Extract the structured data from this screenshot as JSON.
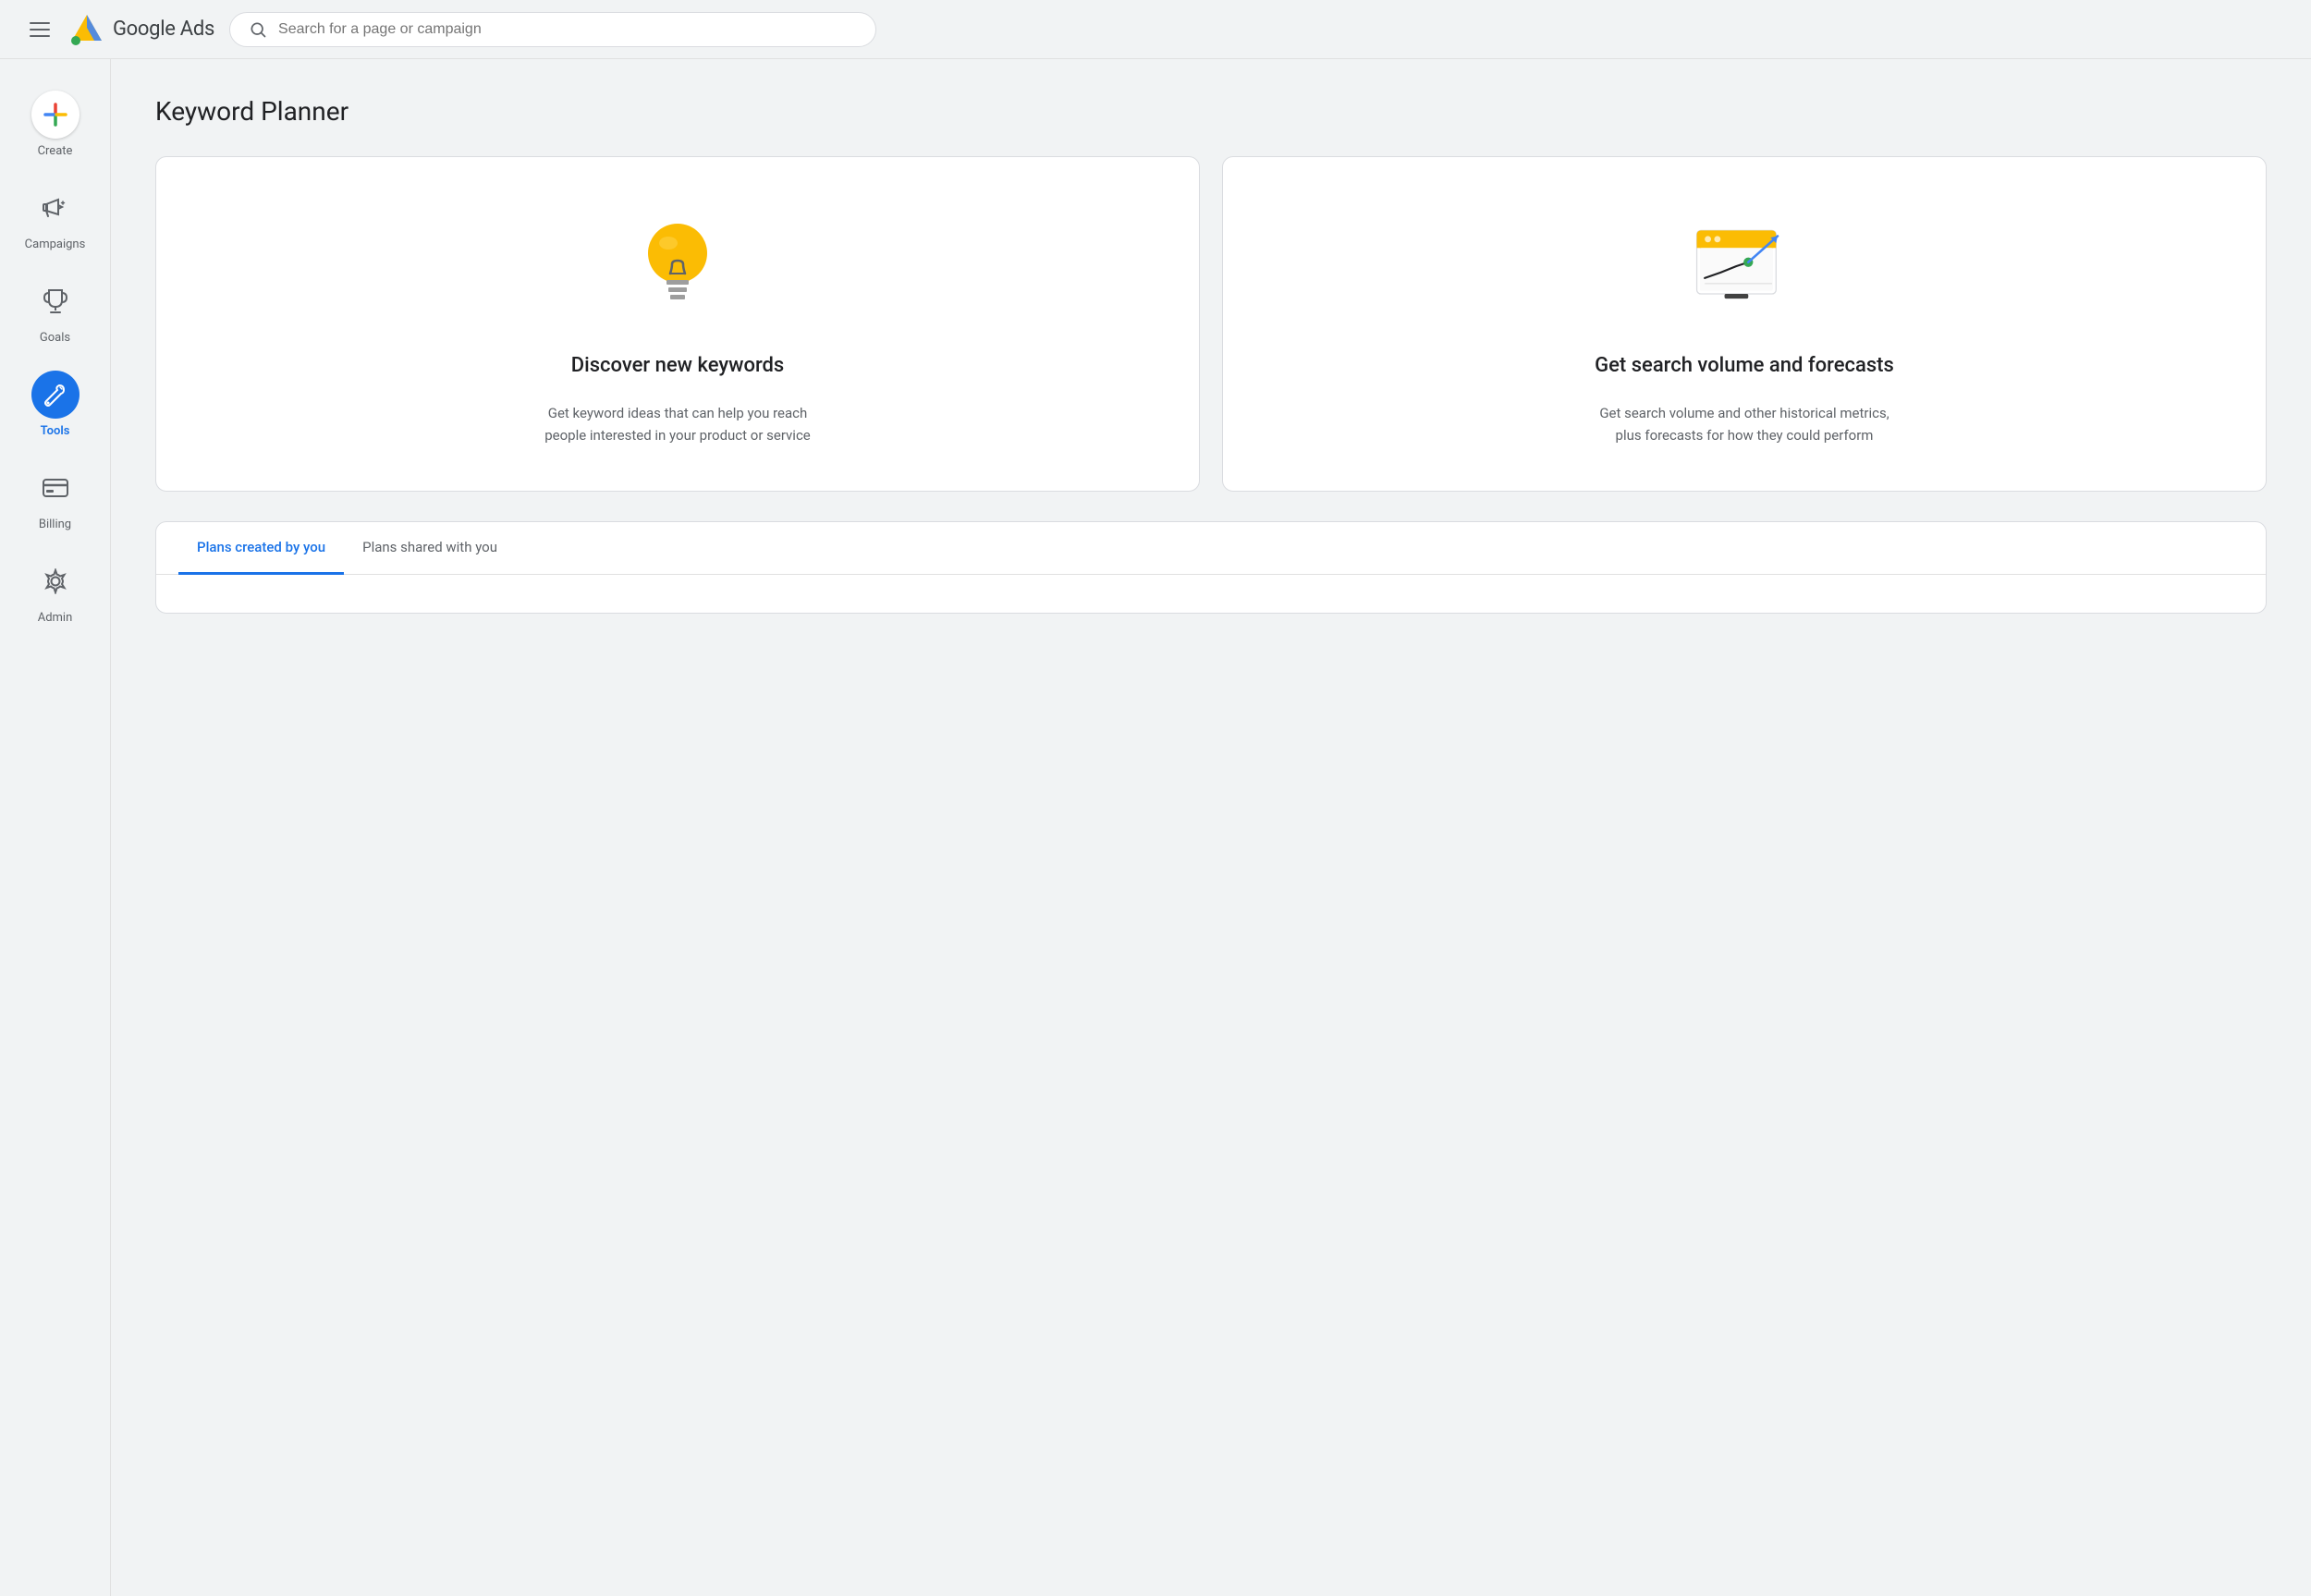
{
  "header": {
    "menu_icon_label": "Menu",
    "logo_alt": "Google Ads logo",
    "app_title": "Google Ads",
    "search_placeholder": "Search for a page or campaign"
  },
  "sidebar": {
    "items": [
      {
        "id": "create",
        "label": "Create",
        "icon": "plus-icon",
        "active": false
      },
      {
        "id": "campaigns",
        "label": "Campaigns",
        "icon": "megaphone-icon",
        "active": false
      },
      {
        "id": "goals",
        "label": "Goals",
        "icon": "trophy-icon",
        "active": false
      },
      {
        "id": "tools",
        "label": "Tools",
        "icon": "wrench-icon",
        "active": true
      },
      {
        "id": "billing",
        "label": "Billing",
        "icon": "creditcard-icon",
        "active": false
      },
      {
        "id": "admin",
        "label": "Admin",
        "icon": "gear-icon",
        "active": false
      }
    ]
  },
  "main": {
    "page_title": "Keyword Planner",
    "cards": [
      {
        "id": "discover",
        "title": "Discover new keywords",
        "description": "Get keyword ideas that can help you reach people interested in your product or service",
        "icon": "lightbulb-icon"
      },
      {
        "id": "forecasts",
        "title": "Get search volume and forecasts",
        "description": "Get search volume and other historical metrics, plus forecasts for how they could perform",
        "icon": "chart-forecast-icon"
      }
    ],
    "tabs": [
      {
        "id": "created-by-you",
        "label": "Plans created by you",
        "active": true
      },
      {
        "id": "shared-with-you",
        "label": "Plans shared with you",
        "active": false
      }
    ]
  },
  "colors": {
    "blue_active": "#1a73e8",
    "google_blue": "#4285F4",
    "google_red": "#EA4335",
    "google_yellow": "#FBBC04",
    "google_green": "#34A853",
    "bulb_yellow": "#FBBC04",
    "text_primary": "#202124",
    "text_secondary": "#5f6368"
  }
}
